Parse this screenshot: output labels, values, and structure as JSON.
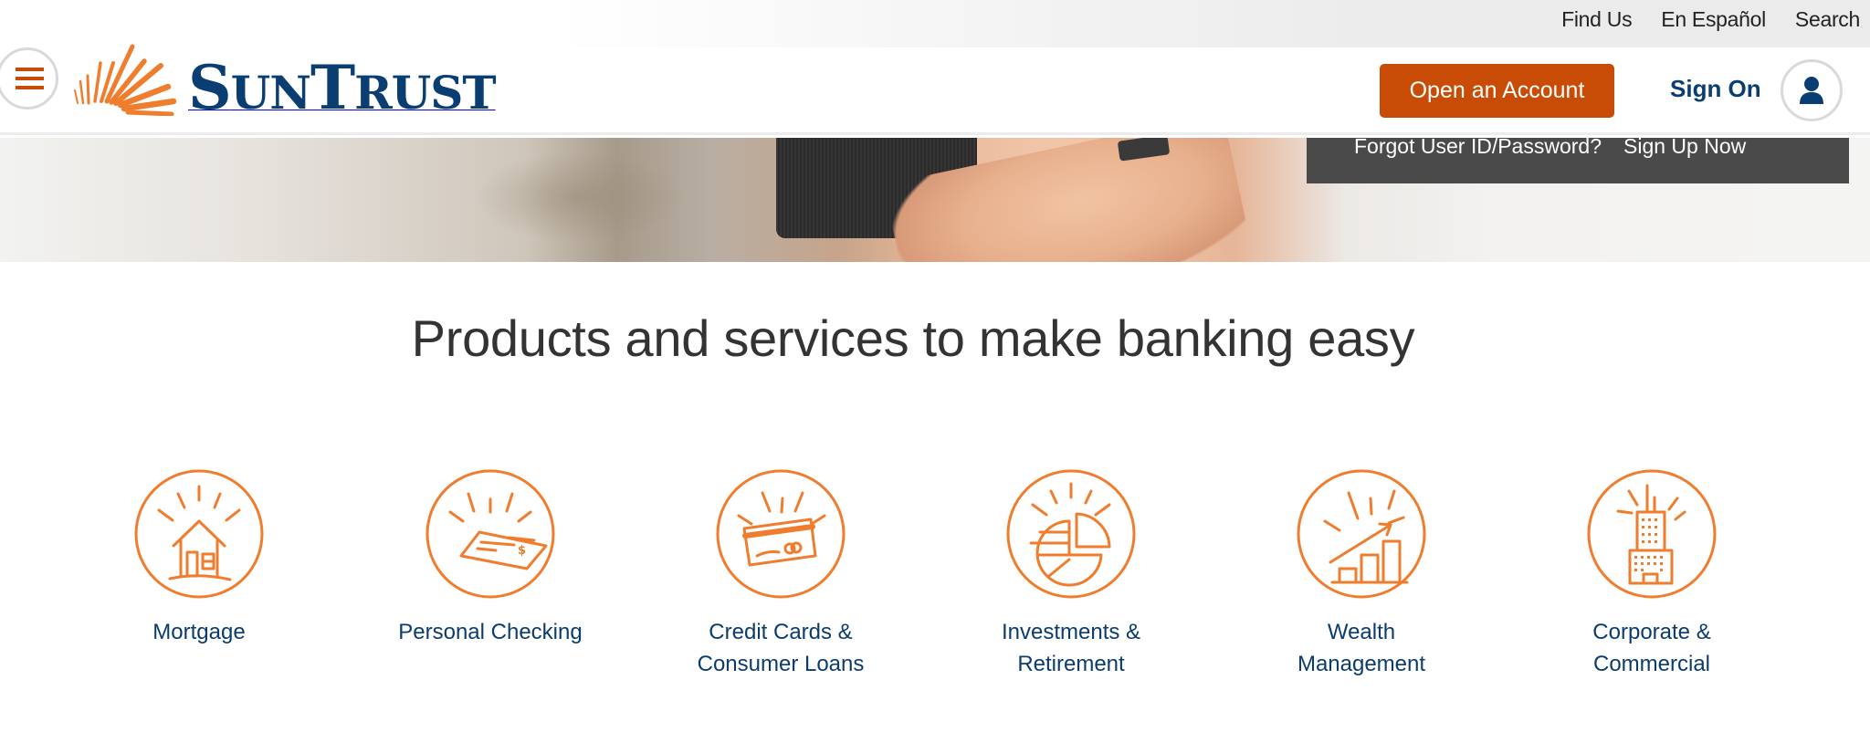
{
  "brand": {
    "name_first_big": "S",
    "name_first_small": "UN",
    "name_second_big": "T",
    "name_second_small": "RUST",
    "primary_color": "#0a3e72",
    "accent_color": "#c94c06",
    "icon_color": "#ef7d2d"
  },
  "utility_nav": {
    "links": [
      {
        "label": "Find Us"
      },
      {
        "label": "En Español"
      },
      {
        "label": "Search"
      }
    ]
  },
  "header": {
    "menu_icon": "hamburger-icon",
    "open_account_label": "Open an Account",
    "sign_on_label": "Sign On",
    "user_icon": "user-icon"
  },
  "signon_panel": {
    "forgot_label": "Forgot User ID/Password?",
    "signup_label": "Sign Up Now"
  },
  "products": {
    "title": "Products and services to make banking easy",
    "items": [
      {
        "label_line1": "Mortgage",
        "label_line2": "",
        "icon": "house-icon"
      },
      {
        "label_line1": "Personal Checking",
        "label_line2": "",
        "icon": "check-icon"
      },
      {
        "label_line1": "Credit Cards &",
        "label_line2": "Consumer Loans",
        "icon": "credit-card-icon"
      },
      {
        "label_line1": "Investments &",
        "label_line2": "Retirement",
        "icon": "pie-chart-icon"
      },
      {
        "label_line1": "Wealth",
        "label_line2": "Management",
        "icon": "growth-chart-icon"
      },
      {
        "label_line1": "Corporate &",
        "label_line2": "Commercial",
        "icon": "building-icon"
      }
    ]
  }
}
